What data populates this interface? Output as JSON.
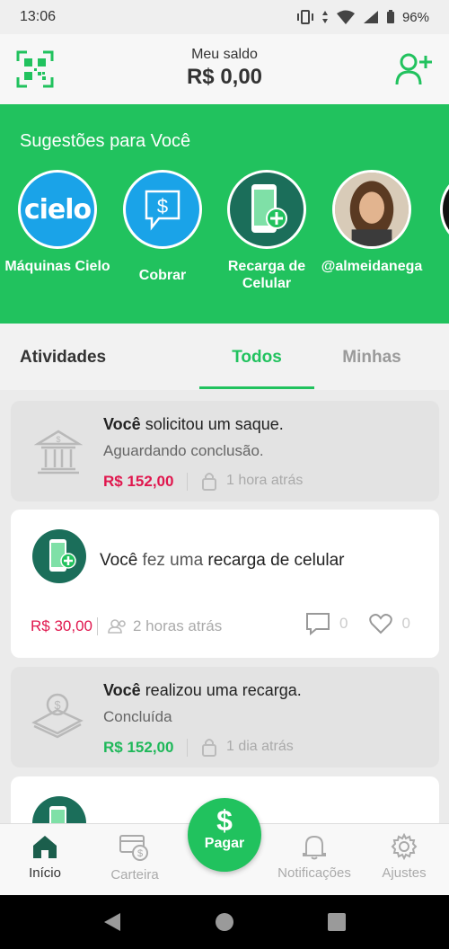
{
  "status_bar": {
    "time": "13:06",
    "battery": "96%"
  },
  "header": {
    "title": "Meu saldo",
    "balance": "R$ 0,00"
  },
  "suggestions": {
    "title": "Sugestões para Você",
    "items": [
      {
        "label": "Máquinas Cielo",
        "logo_text": "cielo",
        "icon": "cielo-logo"
      },
      {
        "label": "Cobrar",
        "icon": "charge-icon"
      },
      {
        "label": "Recarga de Celular",
        "icon": "phone-recharge-icon"
      },
      {
        "label": "@almeidanega",
        "icon": "avatar"
      }
    ]
  },
  "tabs": {
    "left": "Atividades",
    "items": [
      "Todos",
      "Minhas"
    ],
    "active": "Todos"
  },
  "feed": [
    {
      "actor": "Você",
      "text": " solicitou um saque.",
      "sub": "Aguardando conclusão.",
      "amount": "R$ 152,00",
      "time": "1 hora atrás",
      "icon": "bank-icon"
    },
    {
      "text_prefix": "Você",
      "text_mid": " fez uma ",
      "text_bold": "recarga de celular",
      "amount": "R$ 30,00",
      "time": "2 horas atrás",
      "comments": "0",
      "likes": "0",
      "icon": "phone-recharge-icon"
    },
    {
      "actor": "Você",
      "text": " realizou uma recarga.",
      "sub": "Concluída",
      "amount": "R$ 152,00",
      "time": "1 dia atrás",
      "icon": "money-hand-icon"
    }
  ],
  "bottom_nav": {
    "items": [
      {
        "label": "Início",
        "icon": "home-icon"
      },
      {
        "label": "Carteira",
        "icon": "wallet-icon"
      },
      {
        "label": "Notificações",
        "icon": "bell-icon"
      },
      {
        "label": "Ajustes",
        "icon": "gear-icon"
      }
    ],
    "pay_symbol": "$",
    "pay_label": "Pagar"
  },
  "colors": {
    "brand": "#21c25e",
    "negative": "#e0174e",
    "positive": "#1fb85a"
  }
}
